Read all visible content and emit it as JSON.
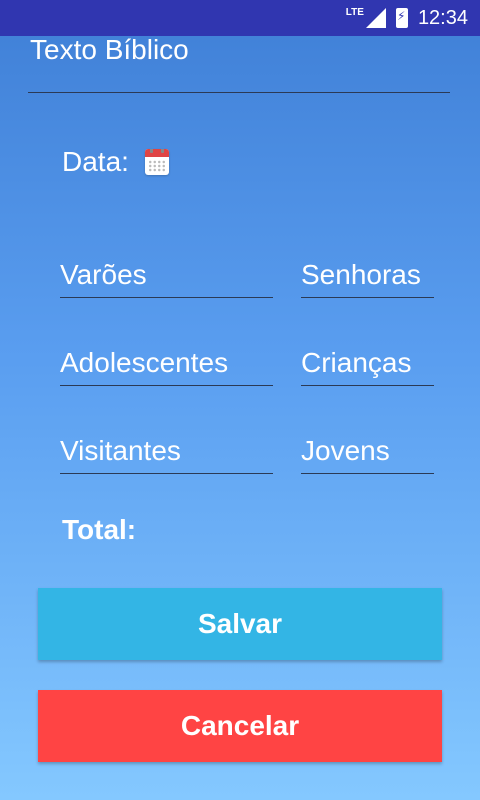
{
  "status_bar": {
    "network": "LTE",
    "time": "12:34"
  },
  "form": {
    "title_hint": "Texto Bíblico",
    "date_label": "Data:",
    "fields": {
      "varoes": "Varões",
      "senhoras": "Senhoras",
      "adolescentes": "Adolescentes",
      "criancas": "Crianças",
      "visitantes": "Visitantes",
      "jovens": "Jovens"
    },
    "total_label": "Total:"
  },
  "buttons": {
    "save": "Salvar",
    "cancel": "Cancelar"
  },
  "colors": {
    "status_bar": "#3036b0",
    "save": "#33b5e5",
    "cancel": "#ff4444"
  }
}
